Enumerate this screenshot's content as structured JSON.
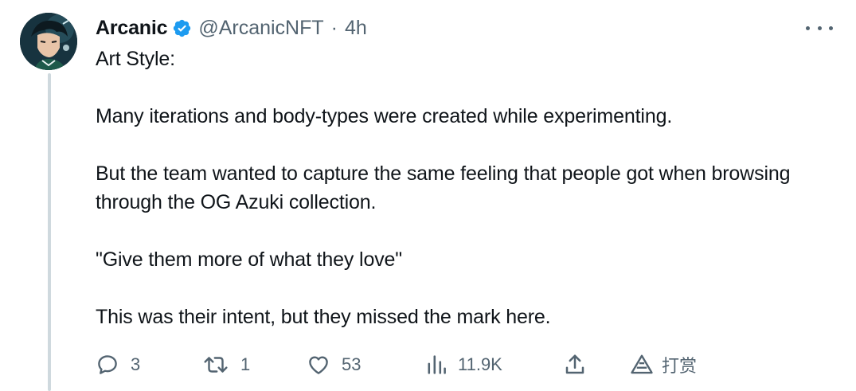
{
  "tweet": {
    "author": {
      "display_name": "Arcanic",
      "handle": "@ArcanicNFT",
      "verified": true,
      "avatar_icon": "anime-character-avatar"
    },
    "separator": "·",
    "time": "4h",
    "more_icon": "ellipsis-icon",
    "body": {
      "line1": "Art Style:",
      "line2": "Many iterations and body-types were created while experimenting.",
      "line3": "But the team wanted to capture the same feeling that people got when browsing through the OG Azuki collection.",
      "line4": "\"Give them more of what they love\"",
      "line5": "This was their intent, but they missed the mark here."
    },
    "actions": {
      "reply": {
        "icon": "reply-bubble-icon",
        "count": "3"
      },
      "retweet": {
        "icon": "retweet-icon",
        "count": "1"
      },
      "like": {
        "icon": "heart-icon",
        "count": "53"
      },
      "views": {
        "icon": "analytics-bars-icon",
        "count": "11.9K"
      },
      "share": {
        "icon": "share-upload-icon"
      },
      "tip": {
        "icon": "tip-triangle-icon",
        "label": "打赏"
      }
    }
  },
  "colors": {
    "text_primary": "#0f1419",
    "text_secondary": "#536471",
    "verified_blue": "#1d9bf0",
    "thread_line": "#cfd9de"
  }
}
